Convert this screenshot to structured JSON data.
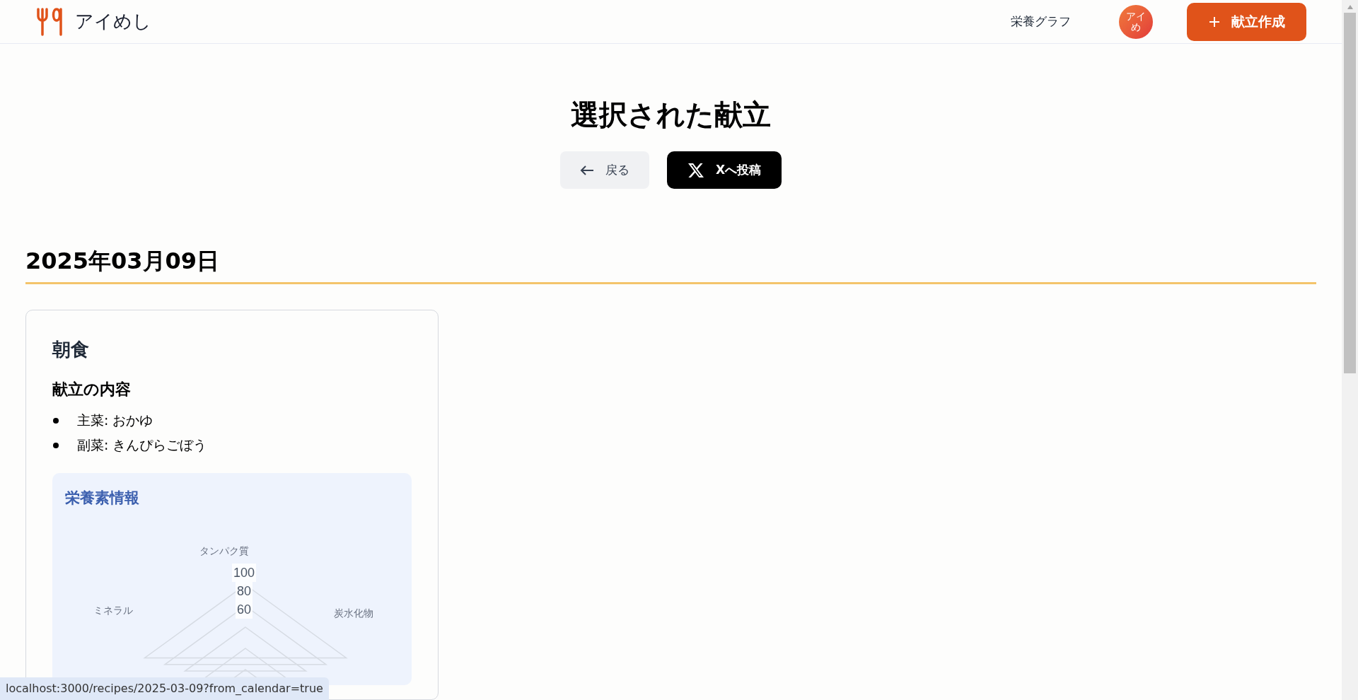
{
  "header": {
    "logo_text": "アイめし",
    "nav_link": "栄養グラフ",
    "avatar_text": "アイめ",
    "create_button": "献立作成"
  },
  "page_title": "選択された献立",
  "actions": {
    "back_button": "戻る",
    "post_button": "Xへ投稿"
  },
  "date_heading": "2025年03月09日",
  "meals": [
    {
      "title": "朝食",
      "contents_heading": "献立の内容",
      "items": [
        {
          "label": "主菜: おかゆ"
        },
        {
          "label": "副菜: きんぴらごぼう"
        }
      ],
      "nutrition": {
        "heading": "栄養素情報",
        "axis_labels": [
          "タンパク質",
          "炭水化物",
          "ミネラル"
        ],
        "ticks": [
          "100",
          "80",
          "60"
        ]
      }
    }
  ],
  "status_bar": {
    "url": "localhost:3000/recipes/2025-03-09?from_calendar=true"
  }
}
